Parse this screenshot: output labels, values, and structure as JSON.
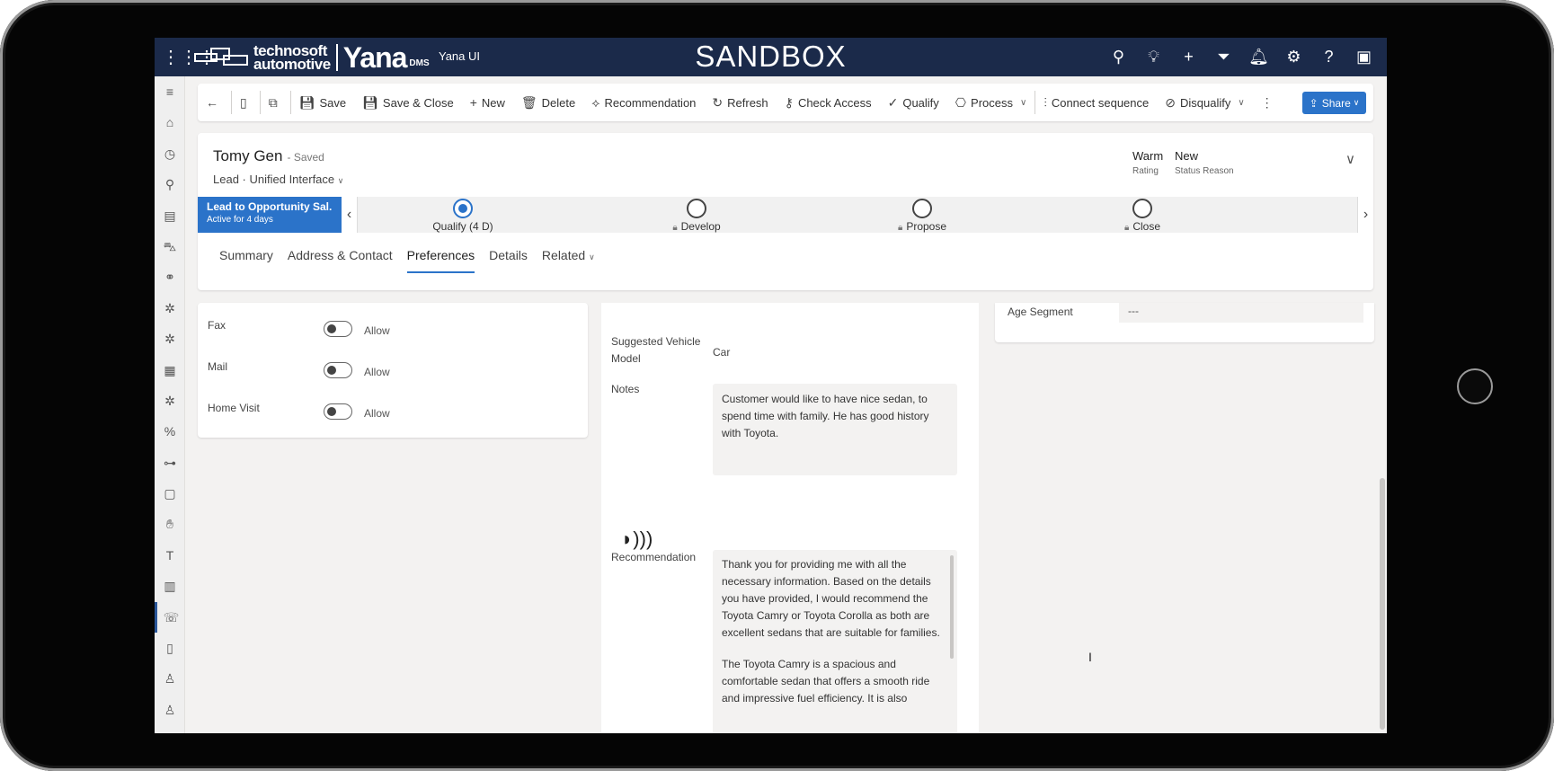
{
  "topbar": {
    "logo_line1": "technosoft",
    "logo_line2": "automotive",
    "logo_brand": "Yana",
    "logo_suffix": "DMS",
    "app_name": "Yana UI",
    "environment": "SANDBOX",
    "icons": [
      "search-icon",
      "lightbulb-icon",
      "plus-icon",
      "filter-icon",
      "bell-icon",
      "gear-icon",
      "help-icon",
      "chat-icon"
    ]
  },
  "leftrail": {
    "icons": [
      "hamburger-icon",
      "home-icon",
      "recent-icon",
      "pin-icon",
      "notebook-icon",
      "car-icon",
      "network-icon",
      "gear-settings-icon",
      "gear-settings-icon",
      "presentation-icon",
      "gear-settings-icon",
      "percent-icon",
      "toggle-icon",
      "document-icon",
      "hand-icon",
      "text-icon",
      "clipboard-icon",
      "phone-icon",
      "book-icon",
      "person-icon",
      "person-search-icon"
    ]
  },
  "commandbar": {
    "save": "Save",
    "save_close": "Save & Close",
    "new": "New",
    "delete": "Delete",
    "recommendation": "Recommendation",
    "refresh": "Refresh",
    "check_access": "Check Access",
    "qualify": "Qualify",
    "process": "Process",
    "connect_sequence": "Connect sequence",
    "disqualify": "Disqualify",
    "share": "Share"
  },
  "record": {
    "name": "Tomy Gen",
    "saved_status": "- Saved",
    "entity": "Lead",
    "form": "Unified Interface",
    "rating_value": "Warm",
    "rating_label": "Rating",
    "status_value": "New",
    "status_label": "Status Reason"
  },
  "bpf": {
    "active_title": "Lead to Opportunity Sal...",
    "active_sub": "Active for 4 days",
    "stages": [
      {
        "label": "Qualify  (4 D)",
        "current": true
      },
      {
        "label": "Develop",
        "current": false
      },
      {
        "label": "Propose",
        "current": false
      },
      {
        "label": "Close",
        "current": false
      }
    ]
  },
  "tabs": [
    "Summary",
    "Address & Contact",
    "Preferences",
    "Details",
    "Related"
  ],
  "preferences": [
    {
      "label": "Fax",
      "toggle_text": "Allow"
    },
    {
      "label": "Mail",
      "toggle_text": "Allow"
    },
    {
      "label": "Home Visit",
      "toggle_text": "Allow"
    }
  ],
  "middle": {
    "vehicle_label_1": "Suggested Vehicle",
    "vehicle_label_2": "Model",
    "vehicle_value": "Car",
    "notes_label": "Notes",
    "notes_value": "Customer would like to have nice sedan, to spend time with family. He has good history with Toyota.",
    "recommendation_label": "Recommendation",
    "recommendation_p1": "Thank you for providing me with all the necessary information. Based on the details you have provided, I would recommend the Toyota Camry or Toyota Corolla as both are excellent sedans that are suitable for families.",
    "recommendation_p2": "The Toyota Camry is a spacious and comfortable sedan that offers a smooth ride and impressive fuel efficiency. It is also"
  },
  "right": {
    "age_label": "Age Segment",
    "age_value": "---"
  },
  "colors": {
    "topbar": "#1b2a4a",
    "accent": "#2b73c9"
  }
}
